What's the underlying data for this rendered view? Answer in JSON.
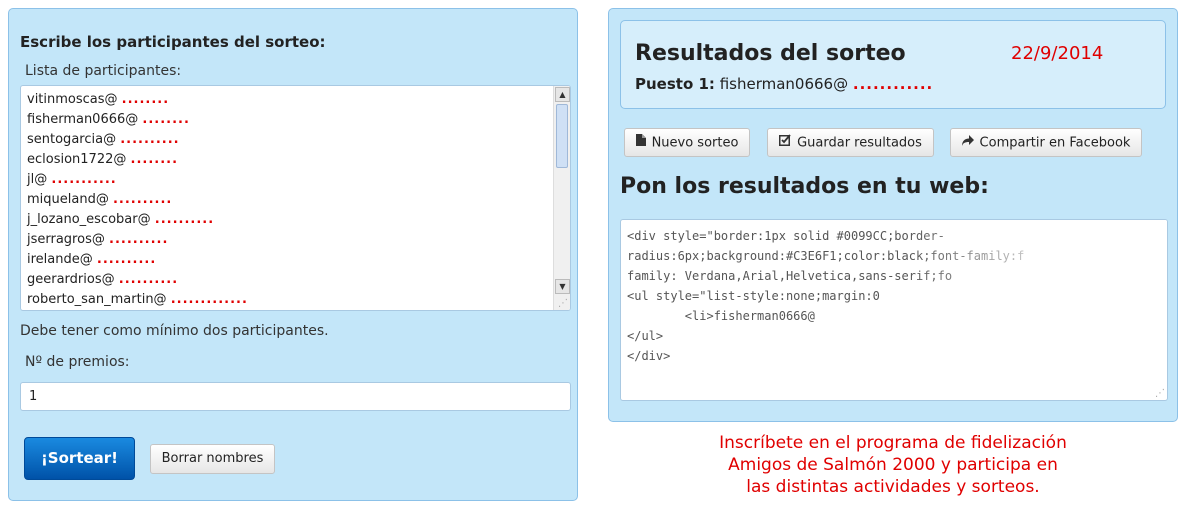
{
  "left": {
    "heading": "Escribe los participantes del sorteo:",
    "list_label": "Lista de participantes:",
    "participants": [
      {
        "name": "vitinmoscas@",
        "redacted": "........"
      },
      {
        "name": "fisherman0666@",
        "redacted": "........"
      },
      {
        "name": "sentogarcia@",
        "redacted": ".........."
      },
      {
        "name": "eclosion1722@",
        "redacted": "........"
      },
      {
        "name": "jl@",
        "redacted": "..........."
      },
      {
        "name": "miqueland@",
        "redacted": ".........."
      },
      {
        "name": "j_lozano_escobar@",
        "redacted": ".........."
      },
      {
        "name": "jserragros@",
        "redacted": ".........."
      },
      {
        "name": "irelande@",
        "redacted": ".........."
      },
      {
        "name": "geerardrios@",
        "redacted": ".........."
      },
      {
        "name": "roberto_san_martin@",
        "redacted": "............."
      }
    ],
    "hint": "Debe tener como mínimo dos participantes.",
    "prizes_label": "Nº de premios:",
    "prizes_value": "1",
    "draw_button": "¡Sortear!",
    "clear_button": "Borrar nombres"
  },
  "right": {
    "results_title": "Resultados del sorteo",
    "results_date": "22/9/2014",
    "result_rank": "Puesto 1:",
    "result_name": "fisherman0666@",
    "result_redacted": "............",
    "buttons": {
      "new": "Nuevo sorteo",
      "save": "Guardar resultados",
      "share": "Compartir en Facebook"
    },
    "embed_heading": "Pon los resultados en tu web:",
    "code_lines": [
      "<div style=\"border:1px solid #0099CC;border-",
      "radius:6px;background:#C3E6F1;color:black;font-family:f",
      "family: Verdana,Arial,Helvetica,sans-serif;fo",
      "<ul style=\"list-style:none;margin:0",
      "        <li>fisherman0666@",
      "</ul>",
      "</div>"
    ]
  },
  "promo": {
    "line1": "Inscríbete en el programa de fidelización",
    "line2": "Amigos de Salmón 2000 y participa en",
    "line3": "las distintas actividades y sorteos."
  },
  "colors": {
    "panel_bg": "#c3e6f9",
    "panel_border": "#8cc1e8",
    "primary_button": "#0060c0",
    "accent_red": "#e00000"
  },
  "icons": {
    "new": "document-icon",
    "save": "edit-check-icon",
    "share": "share-arrow-icon"
  }
}
